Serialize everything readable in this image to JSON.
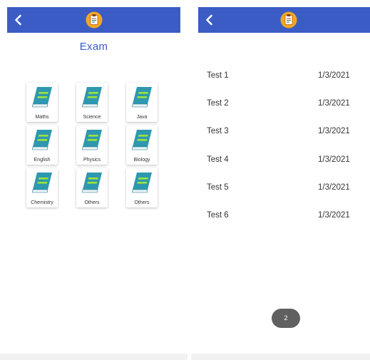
{
  "left_screen": {
    "page_title": "Exam",
    "subjects": [
      {
        "label": "Maths"
      },
      {
        "label": "Science"
      },
      {
        "label": "Java"
      },
      {
        "label": "English"
      },
      {
        "label": "Physics"
      },
      {
        "label": "Biology"
      },
      {
        "label": "Chemistry"
      },
      {
        "label": "Others"
      },
      {
        "label": "Others"
      }
    ]
  },
  "right_screen": {
    "tests": [
      {
        "name": "Test 1",
        "date": "1/3/2021"
      },
      {
        "name": "Test 2",
        "date": "1/3/2021"
      },
      {
        "name": "Test 3",
        "date": "1/3/2021"
      },
      {
        "name": "Test 4",
        "date": "1/3/2021"
      },
      {
        "name": "Test 5",
        "date": "1/3/2021"
      },
      {
        "name": "Test 6",
        "date": "1/3/2021"
      }
    ],
    "page_indicator": "2"
  },
  "icons": {
    "back": "chevron-left-icon",
    "logo": "clipboard-app-icon",
    "subject": "book-icon"
  },
  "colors": {
    "appbar": "#3b5cc5",
    "title": "#3b5cc5",
    "book_cover": "#2e98b0",
    "book_stripe": "#9be23b",
    "pill": "#606060"
  }
}
